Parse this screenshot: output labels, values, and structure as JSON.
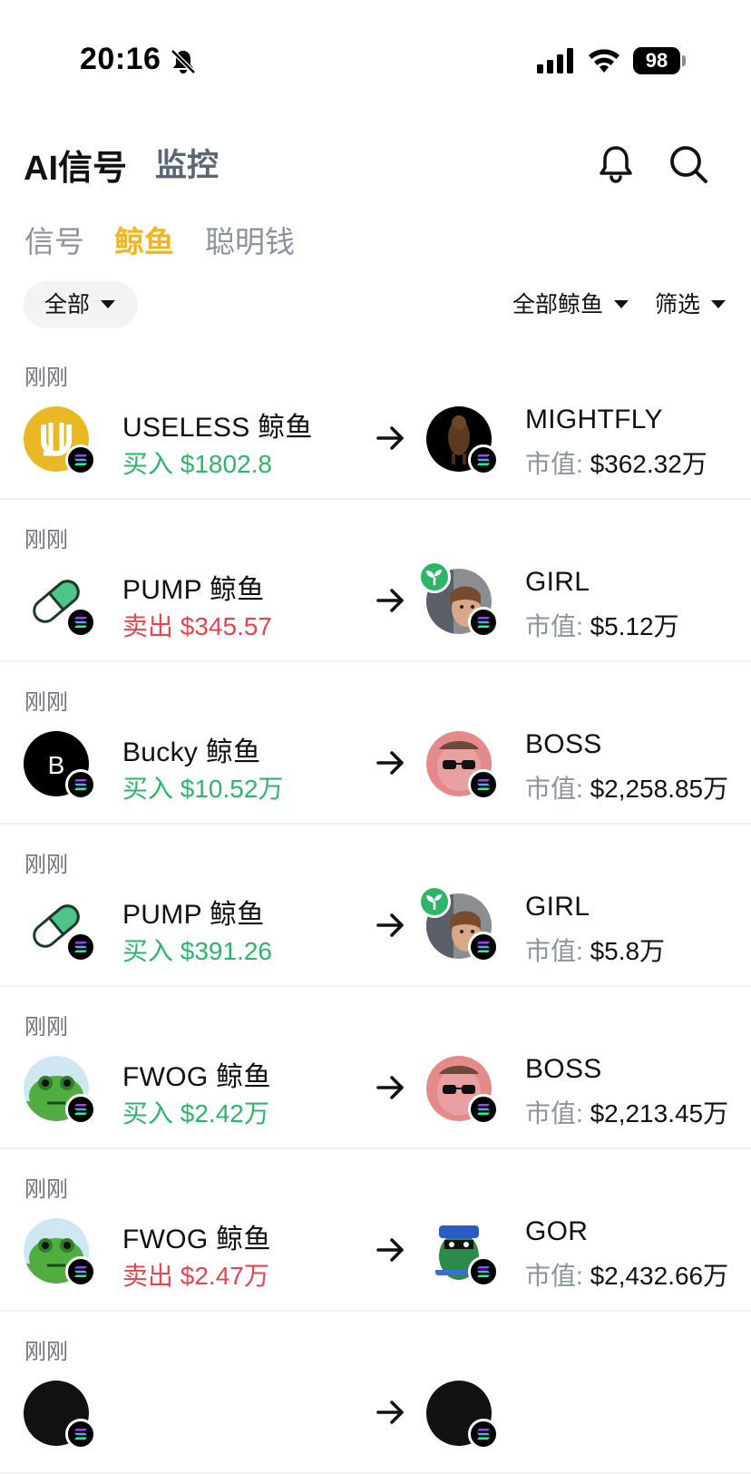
{
  "status": {
    "time": "20:16",
    "battery": "98"
  },
  "header": {
    "title": "AI信号",
    "monitor": "监控"
  },
  "tabs": [
    {
      "label": "信号",
      "active": false
    },
    {
      "label": "鲸鱼",
      "active": true
    },
    {
      "label": "聪明钱",
      "active": false
    }
  ],
  "filters": {
    "all": "全部",
    "all_whales": "全部鲸鱼",
    "screen": "筛选"
  },
  "colors": {
    "accent": "#f2b51e",
    "buy": "#2fb56a",
    "sell": "#e5454f"
  },
  "mcap_label": "市值:",
  "rows": [
    {
      "time": "刚刚",
      "whale": "USELESS 鲸鱼",
      "action": "买入 $1802.8",
      "side": "buy",
      "token": "MIGHTFLY",
      "mcap": "$362.32万",
      "whale_icon": "useless-logo-icon",
      "token_icon": "mightfly-token-icon"
    },
    {
      "time": "刚刚",
      "whale": "PUMP 鲸鱼",
      "action": "卖出 $345.57",
      "side": "sell",
      "token": "GIRL",
      "mcap": "$5.12万",
      "whale_icon": "pill-icon",
      "token_icon": "girl-token-icon"
    },
    {
      "time": "刚刚",
      "whale": "Bucky 鲸鱼",
      "action": "买入 $10.52万",
      "side": "buy",
      "token": "BOSS",
      "mcap": "$2,258.85万",
      "whale_icon": "letter-b-icon",
      "token_icon": "boss-token-icon",
      "whale_letter": "B"
    },
    {
      "time": "刚刚",
      "whale": "PUMP 鲸鱼",
      "action": "买入 $391.26",
      "side": "buy",
      "token": "GIRL",
      "mcap": "$5.8万",
      "whale_icon": "pill-icon",
      "token_icon": "girl-token-icon"
    },
    {
      "time": "刚刚",
      "whale": "FWOG 鲸鱼",
      "action": "买入 $2.42万",
      "side": "buy",
      "token": "BOSS",
      "mcap": "$2,213.45万",
      "whale_icon": "frog-icon",
      "token_icon": "boss-token-icon"
    },
    {
      "time": "刚刚",
      "whale": "FWOG 鲸鱼",
      "action": "卖出 $2.47万",
      "side": "sell",
      "token": "GOR",
      "mcap": "$2,432.66万",
      "whale_icon": "frog-icon",
      "token_icon": "gor-token-icon"
    },
    {
      "time": "刚刚",
      "whale": "",
      "action": "",
      "side": "buy",
      "token": "",
      "mcap": "",
      "whale_icon": "dark-avatar-icon",
      "token_icon": "dark-avatar-icon"
    }
  ]
}
